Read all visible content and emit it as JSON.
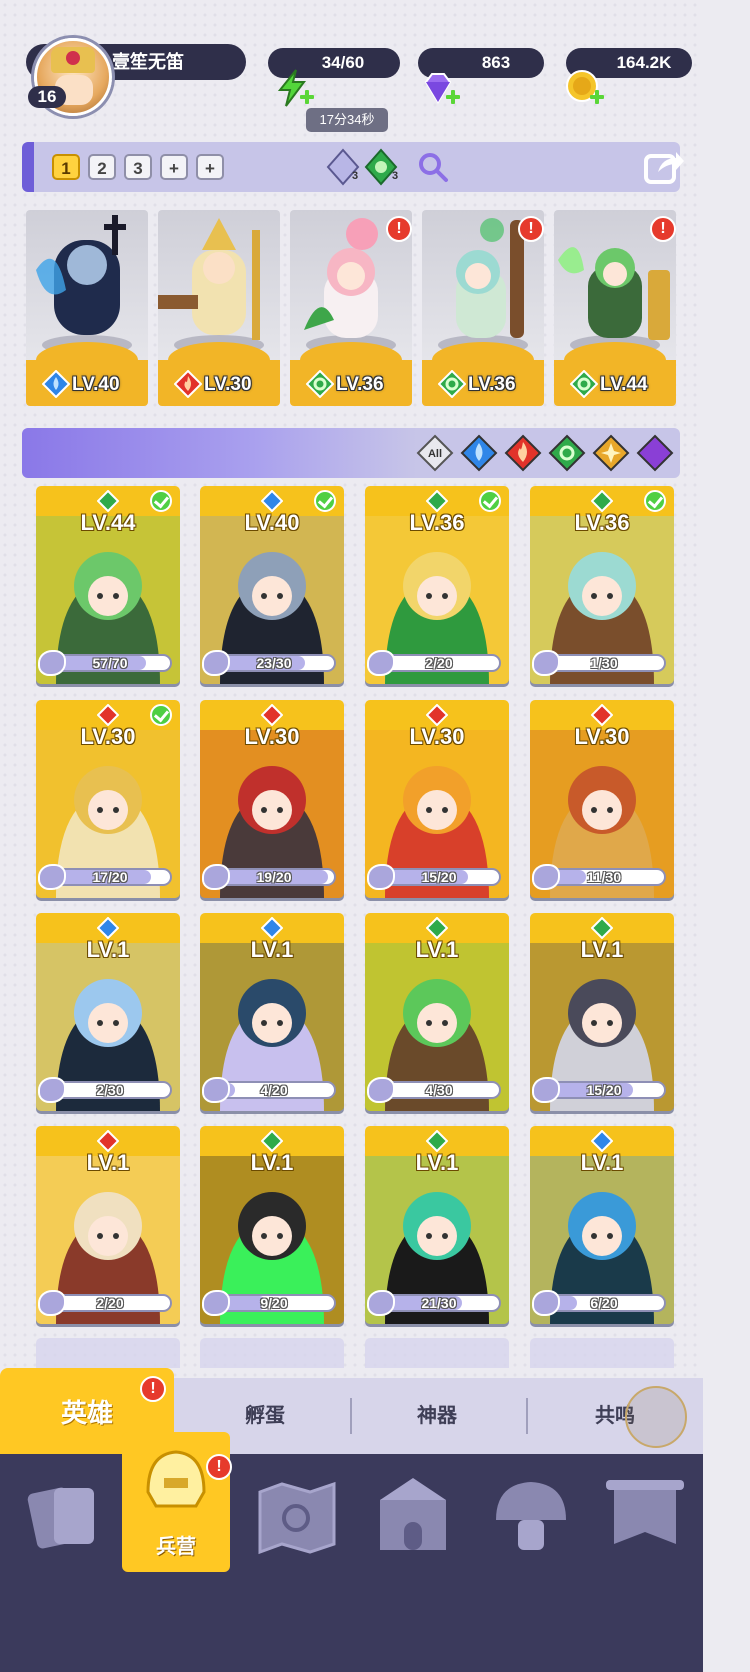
{
  "player": {
    "name": "壹笙无笛",
    "level": "16"
  },
  "resources": {
    "energy": "34/60",
    "energy_timer": "17分34秒",
    "gems": "863",
    "gold": "164.2K"
  },
  "team_tabs": [
    "1",
    "2",
    "3"
  ],
  "team_icons": {
    "skill_a_count": "3",
    "skill_b_count": "3"
  },
  "team": [
    {
      "level": "LV.40",
      "element": "water",
      "stars": "★",
      "alert": false
    },
    {
      "level": "LV.30",
      "element": "fire",
      "stars": "",
      "alert": false
    },
    {
      "level": "LV.36",
      "element": "nature",
      "stars": "",
      "alert": true
    },
    {
      "level": "LV.36",
      "element": "nature",
      "stars": "★",
      "alert": true
    },
    {
      "level": "LV.44",
      "element": "nature",
      "stars": "★★★",
      "alert": true
    }
  ],
  "filters": [
    "All",
    "water",
    "fire",
    "nature",
    "light",
    "dark"
  ],
  "heroes": [
    {
      "level": "LV.44",
      "element": "nature",
      "progress": "57/70",
      "ratio": 0.81,
      "selected": true
    },
    {
      "level": "LV.40",
      "element": "water",
      "progress": "23/30",
      "ratio": 0.77,
      "selected": true
    },
    {
      "level": "LV.36",
      "element": "nature",
      "progress": "2/20",
      "ratio": 0.1,
      "selected": true
    },
    {
      "level": "LV.36",
      "element": "nature",
      "progress": "1/30",
      "ratio": 0.03,
      "selected": true
    },
    {
      "level": "LV.30",
      "element": "fire",
      "progress": "17/20",
      "ratio": 0.85,
      "selected": true
    },
    {
      "level": "LV.30",
      "element": "fire",
      "progress": "19/20",
      "ratio": 0.95,
      "selected": false
    },
    {
      "level": "LV.30",
      "element": "fire",
      "progress": "15/20",
      "ratio": 0.75,
      "selected": false
    },
    {
      "level": "LV.30",
      "element": "fire",
      "progress": "11/30",
      "ratio": 0.37,
      "selected": false
    },
    {
      "level": "LV.1",
      "element": "water",
      "progress": "2/30",
      "ratio": 0.07,
      "selected": false
    },
    {
      "level": "LV.1",
      "element": "water",
      "progress": "4/20",
      "ratio": 0.2,
      "selected": false
    },
    {
      "level": "LV.1",
      "element": "nature",
      "progress": "4/30",
      "ratio": 0.13,
      "selected": false
    },
    {
      "level": "LV.1",
      "element": "nature",
      "progress": "15/20",
      "ratio": 0.75,
      "selected": false
    },
    {
      "level": "LV.1",
      "element": "fire",
      "progress": "2/20",
      "ratio": 0.1,
      "selected": false
    },
    {
      "level": "LV.1",
      "element": "nature",
      "progress": "9/20",
      "ratio": 0.45,
      "selected": false
    },
    {
      "level": "LV.1",
      "element": "nature",
      "progress": "21/30",
      "ratio": 0.7,
      "selected": false
    },
    {
      "level": "LV.1",
      "element": "water",
      "progress": "6/20",
      "ratio": 0.3,
      "selected": false
    }
  ],
  "tabs": {
    "heroes": "英雄",
    "hatch": "孵蛋",
    "artifact": "神器",
    "resonance": "共鸣"
  },
  "nav": {
    "barracks": "兵营"
  },
  "colors": {
    "water": "#2f86e8",
    "fire": "#e2332a",
    "nature": "#2faa4a",
    "light": "#e8a72a",
    "dark": "#8a3fd6",
    "gold_card": "#f6c21c"
  }
}
